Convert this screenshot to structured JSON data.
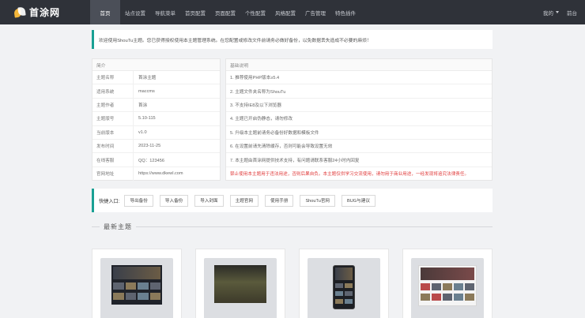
{
  "brand": {
    "name": "首涂网"
  },
  "nav": [
    {
      "label": "首页",
      "active": true
    },
    {
      "label": "站点设置",
      "active": false
    },
    {
      "label": "导航菜单",
      "active": false
    },
    {
      "label": "首页配置",
      "active": false
    },
    {
      "label": "页面配置",
      "active": false
    },
    {
      "label": "个性配置",
      "active": false
    },
    {
      "label": "风格配置",
      "active": false
    },
    {
      "label": "广告管理",
      "active": false
    },
    {
      "label": "特色插件",
      "active": false
    }
  ],
  "topright": {
    "user": "我的",
    "home": "前台"
  },
  "notice": {
    "text": "欢迎使用ShouTu主题。您已获得授权使用本主题管理系统。在您配置或修改文件前请务必做好备份，以免数据丢失造成不必要的麻烦！"
  },
  "info": {
    "title": "简介",
    "rows": [
      {
        "key": "主题名称",
        "value": "首涂主题"
      },
      {
        "key": "适用系统",
        "value": "maccms"
      },
      {
        "key": "主题作者",
        "value": "首涂"
      },
      {
        "key": "主题版号",
        "value": "5.10-115"
      },
      {
        "key": "当前版本",
        "value": "v1.0"
      },
      {
        "key": "发布时间",
        "value": "2023-11-25"
      },
      {
        "key": "在线客服",
        "value": "QQ：123456"
      },
      {
        "key": "官网地址",
        "value": "https://www.dkewl.com"
      }
    ]
  },
  "intro": {
    "title": "基础说明",
    "rows": [
      {
        "text": "1. 推荐使用PHP版本≥5.4",
        "red": false
      },
      {
        "text": "2. 主题文件夹名称为ShouTu",
        "red": false
      },
      {
        "text": "3. 不支持IE8及以下浏览器",
        "red": false
      },
      {
        "text": "4. 主题已开启伪静态，请勿修改",
        "red": false
      },
      {
        "text": "5. 升级本主题前请务必备份好数据和模板文件",
        "red": false
      },
      {
        "text": "6. 在设置前请先清除缓存，否则可能会导致设置无效",
        "red": false
      },
      {
        "text": "7. 本主题由首涂网提供技术支持，有问题请联系客服24小时内回复",
        "red": false
      },
      {
        "text": "禁止使用本主题用于违法用途，否则后果自负。本主题仅供学习交流使用，请勿用于商业用途，一经发现将追究法律责任。",
        "red": true
      }
    ]
  },
  "quick": {
    "label": "快捷入口:",
    "buttons": [
      "导出备份",
      "导入备份",
      "导入封面",
      "主题官网",
      "使用手册",
      "ShouTu官网",
      "BUG与建议"
    ]
  },
  "latest": {
    "title": "最新主题"
  }
}
